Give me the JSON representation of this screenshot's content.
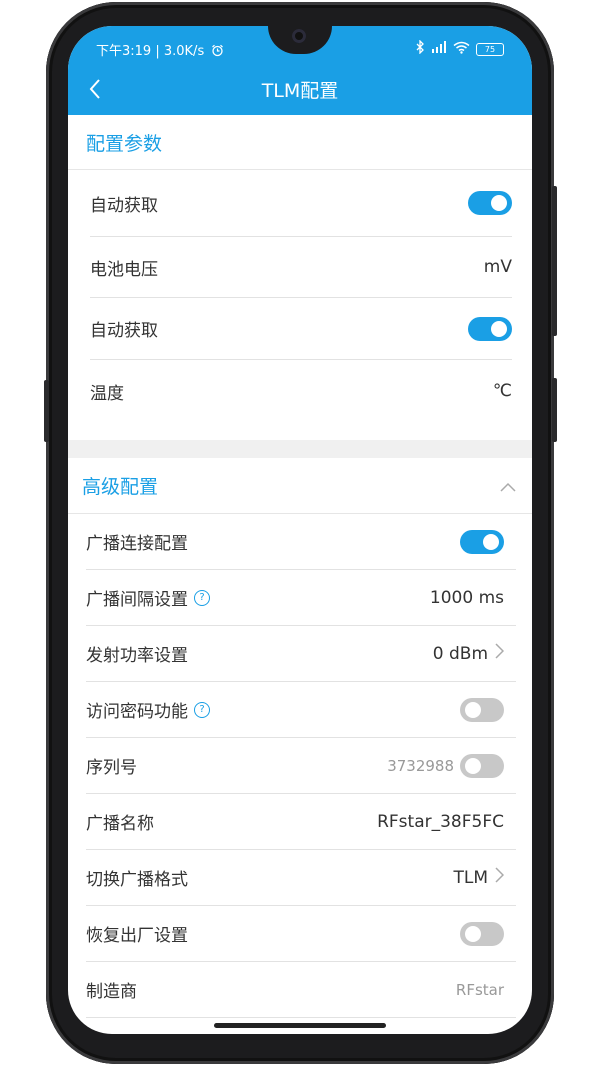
{
  "status_bar": {
    "time": "下午3:19",
    "speed": "3.0K/s",
    "battery": "75"
  },
  "header": {
    "title": "TLM配置"
  },
  "config_params": {
    "title": "配置参数",
    "rows": [
      {
        "label": "自动获取",
        "type": "toggle",
        "on": true
      },
      {
        "label": "电池电压",
        "value": "mV"
      },
      {
        "label": "自动获取",
        "type": "toggle",
        "on": true
      },
      {
        "label": "温度",
        "value": "℃"
      }
    ]
  },
  "advanced": {
    "title": "高级配置",
    "rows": [
      {
        "label": "广播连接配置",
        "type": "toggle",
        "on": true
      },
      {
        "label": "广播间隔设置",
        "value": "1000 ms",
        "help": "?"
      },
      {
        "label": "发射功率设置",
        "value": "0 dBm",
        "chevron": "chevron-right-icon"
      },
      {
        "label": "访问密码功能",
        "type": "toggle",
        "on": false,
        "help": "?"
      },
      {
        "label": "序列号",
        "value": "3732988",
        "type": "toggle",
        "on": false
      },
      {
        "label": "广播名称",
        "value": "RFstar_38F5FC"
      },
      {
        "label": "切换广播格式",
        "value": "TLM",
        "chevron": "chevron-right-icon"
      },
      {
        "label": "恢复出厂设置",
        "type": "toggle",
        "on": false
      },
      {
        "label": "制造商",
        "value": "RFstar"
      }
    ]
  },
  "colors": {
    "accent": "#1a9fe5",
    "toggle_off": "#c8c8c8",
    "divider": "#f0f0f0"
  }
}
